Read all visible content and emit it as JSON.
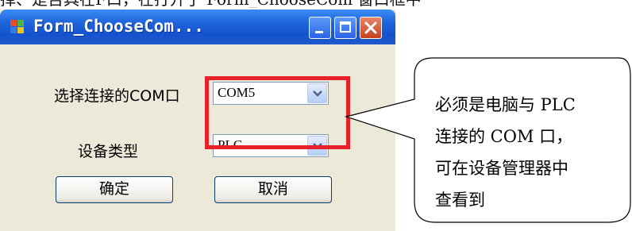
{
  "top_strip_text": "择、是否具在F口，在打开了 Form_ChooseCom 窗口框中",
  "window": {
    "title": "Form_ChooseCom...",
    "app_icon": "app-window-icon",
    "caption_buttons": [
      "minimize-icon",
      "maximize-icon",
      "close-icon"
    ]
  },
  "form": {
    "com_label": "选择连接的COM口",
    "com_value": "COM5",
    "device_label": "设备类型",
    "device_value": "PLC",
    "ok_button": "确定",
    "cancel_button": "取消"
  },
  "callout": {
    "lines": [
      "必须是电脑与 PLC",
      "连接的 COM 口，",
      "可在设备管理器中",
      "查看到"
    ]
  },
  "colors": {
    "titlebar": "#2166dd",
    "window_bg": "#ece9d8",
    "highlight": "#e8202a",
    "close_button": "#c5411e"
  }
}
